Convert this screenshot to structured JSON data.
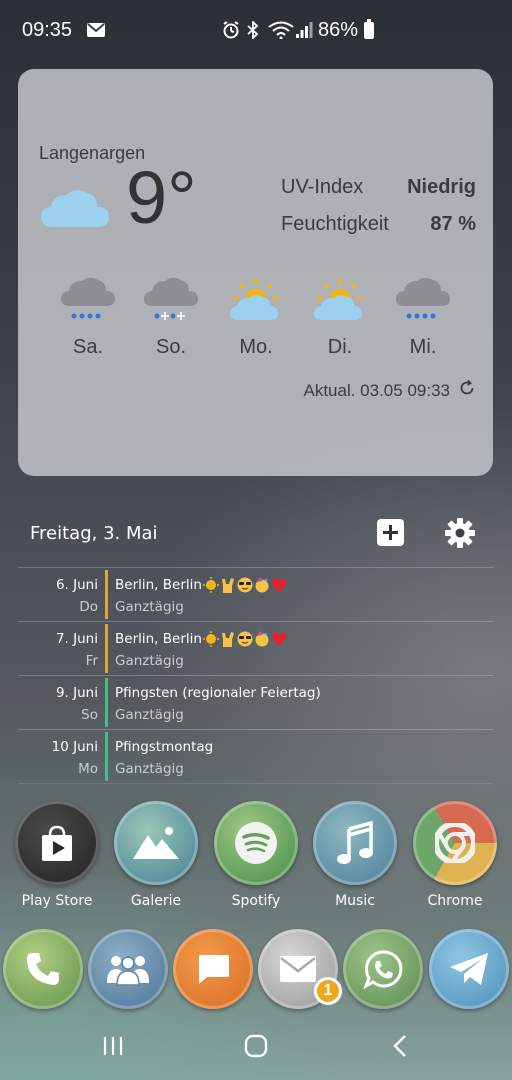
{
  "status_bar": {
    "time": "09:35",
    "battery": "86%"
  },
  "weather": {
    "location": "Langenargen",
    "temperature": "9°",
    "current_icon": "cloud-icon",
    "uv_label": "UV-Index",
    "uv_value": "Niedrig",
    "humidity_label": "Feuchtigkeit",
    "humidity_value": "87 %",
    "forecast": [
      {
        "day": "Sa.",
        "icon": "rain-cloud-icon"
      },
      {
        "day": "So.",
        "icon": "snow-rain-cloud-icon"
      },
      {
        "day": "Mo.",
        "icon": "partly-sunny-icon"
      },
      {
        "day": "Di.",
        "icon": "partly-sunny-icon"
      },
      {
        "day": "Mi.",
        "icon": "rain-cloud-icon"
      }
    ],
    "updated": "Aktual. 03.05 09:33"
  },
  "calendar": {
    "date": "Freitag, 3. Mai",
    "events": [
      {
        "date": "6. Juni",
        "weekday": "Do",
        "title": "Berlin, Berlin",
        "subtitle": "Ganztägig",
        "color": "#e0a43a",
        "emoji": true
      },
      {
        "date": "7. Juni",
        "weekday": "Fr",
        "title": "Berlin, Berlin",
        "subtitle": "Ganztägig",
        "color": "#e0a43a",
        "emoji": true
      },
      {
        "date": "9. Juni",
        "weekday": "So",
        "title": "Pfingsten (regionaler Feiertag)",
        "subtitle": "Ganztägig",
        "color": "#3fbf8a",
        "emoji": false
      },
      {
        "date": "10 Juni",
        "weekday": "Mo",
        "title": "Pfingstmontag",
        "subtitle": "Ganztägig",
        "color": "#3fbf8a",
        "emoji": false
      }
    ]
  },
  "apps": [
    {
      "label": "Play Store",
      "icon": "play-store-icon"
    },
    {
      "label": "Galerie",
      "icon": "gallery-icon"
    },
    {
      "label": "Spotify",
      "icon": "spotify-icon"
    },
    {
      "label": "Music",
      "icon": "music-icon"
    },
    {
      "label": "Chrome",
      "icon": "chrome-icon"
    }
  ],
  "dock": [
    {
      "icon": "phone-icon"
    },
    {
      "icon": "contacts-icon"
    },
    {
      "icon": "messages-icon"
    },
    {
      "icon": "email-icon",
      "badge": "1"
    },
    {
      "icon": "whatsapp-icon"
    },
    {
      "icon": "telegram-icon"
    }
  ]
}
